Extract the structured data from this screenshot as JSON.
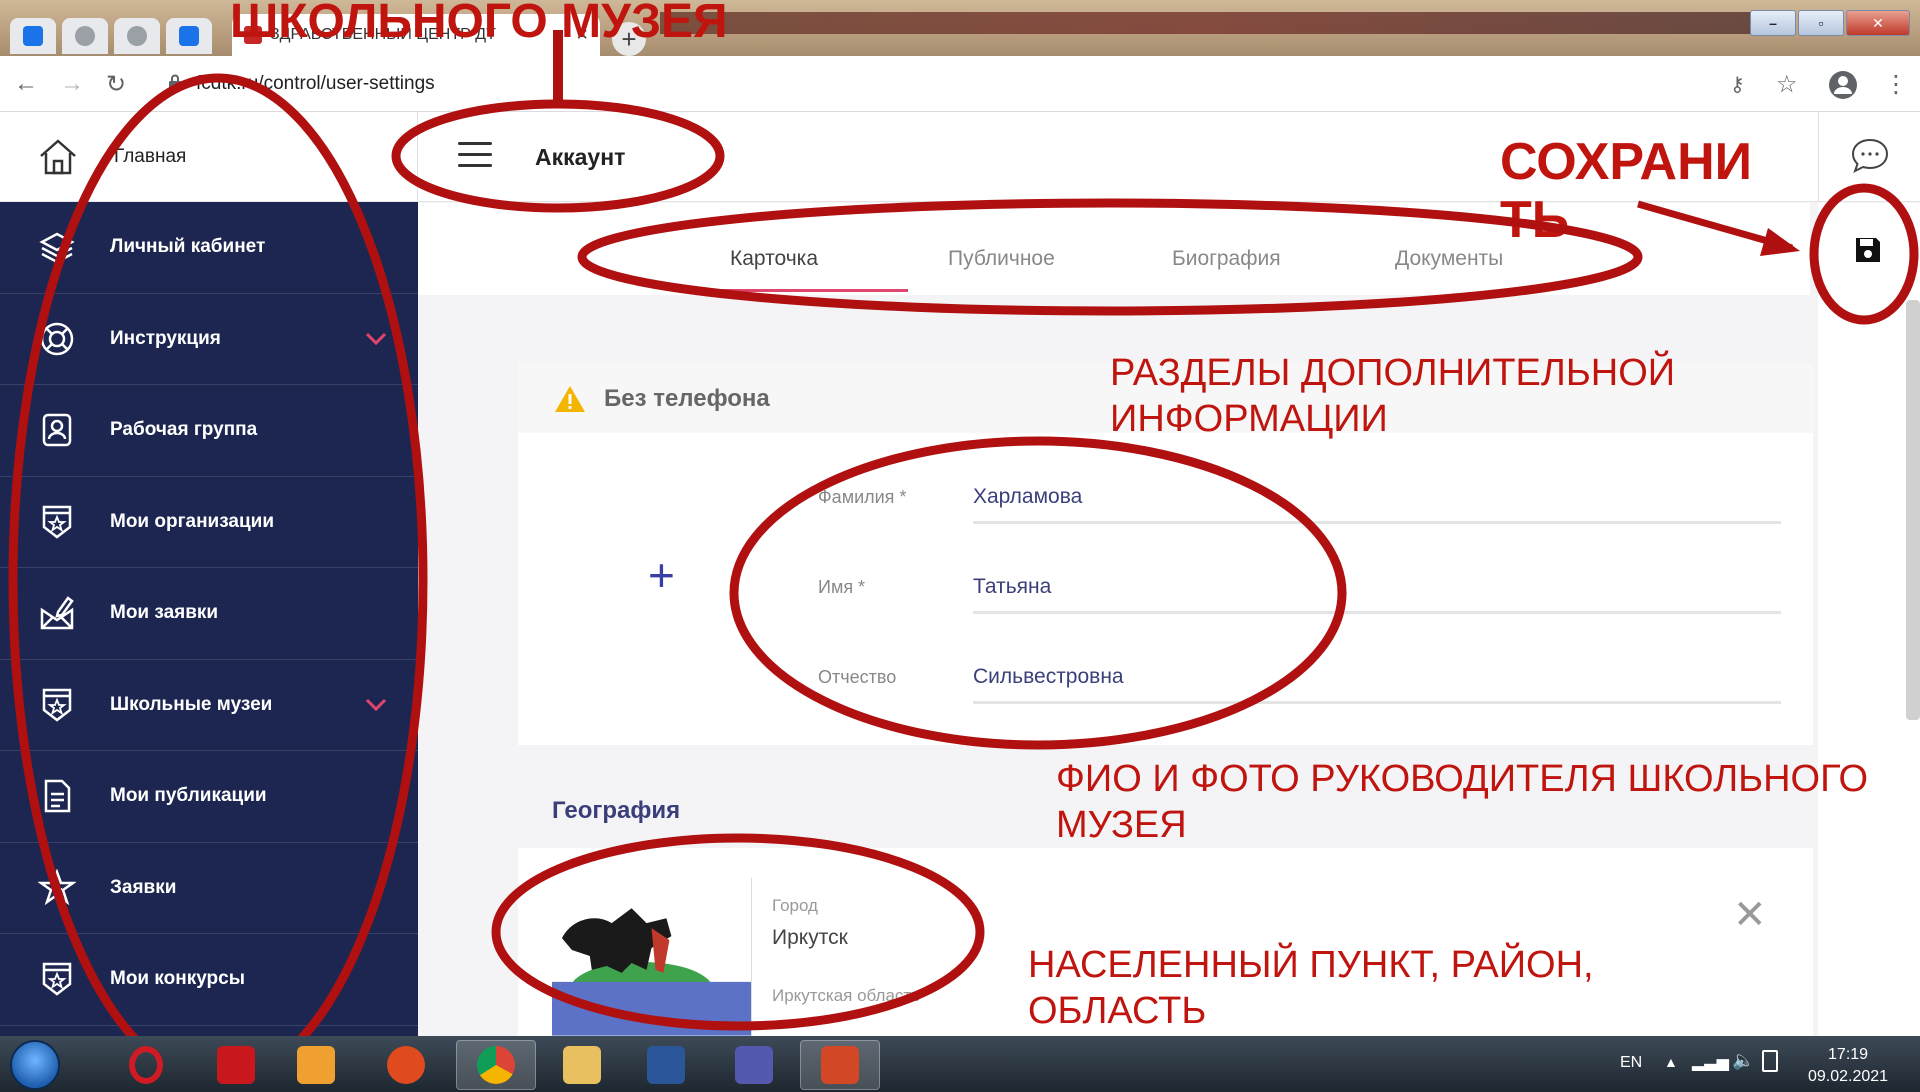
{
  "browser": {
    "active_tab_title": "ЗДРАВСТВЕННЫЙ ЦЕНТР ДТ",
    "url": "fcdtk.ru/control/user-settings"
  },
  "sidebar": {
    "home_label": "Главная",
    "items": [
      {
        "label": "Личный кабинет",
        "icon": "layers-icon",
        "expandable": false
      },
      {
        "label": "Инструкция",
        "icon": "lifebuoy-icon",
        "expandable": true
      },
      {
        "label": "Рабочая группа",
        "icon": "user-badge-icon",
        "expandable": false
      },
      {
        "label": "Мои организации",
        "icon": "star-shield-icon",
        "expandable": false
      },
      {
        "label": "Мои заявки",
        "icon": "envelope-edit-icon",
        "expandable": false
      },
      {
        "label": "Школьные музеи",
        "icon": "star-shield-icon",
        "expandable": true
      },
      {
        "label": "Мои публикации",
        "icon": "document-icon",
        "expandable": false
      },
      {
        "label": "Заявки",
        "icon": "star-burst-icon",
        "expandable": false
      },
      {
        "label": "Мои конкурсы",
        "icon": "star-shield-icon",
        "expandable": false
      }
    ]
  },
  "header": {
    "title": "Аккаунт"
  },
  "tabs": [
    {
      "label": "Карточка",
      "active": true
    },
    {
      "label": "Публичное",
      "active": false
    },
    {
      "label": "Биография",
      "active": false
    },
    {
      "label": "Документы",
      "active": false
    }
  ],
  "card": {
    "warning": "Без телефона",
    "fields": [
      {
        "label": "Фамилия *",
        "value": "Харламова"
      },
      {
        "label": "Имя *",
        "value": "Татьяна"
      },
      {
        "label": "Отчество",
        "value": "Сильвестровна"
      }
    ]
  },
  "geography": {
    "title": "География",
    "city_label": "Город",
    "city": "Иркутск",
    "region": "Иркутская область"
  },
  "annotations": {
    "top_heading": "ШКОЛЬНОГО МУЗЕЯ",
    "save_line1": "СОХРАНИ",
    "save_line2": "ТЬ",
    "sections_line1": "РАЗДЕЛЫ ДОПОЛНИТЕЛЬНОЙ",
    "sections_line2": "ИНФОРМАЦИИ",
    "fio_line1": "ФИО И ФОТО РУКОВОДИТЕЛЯ ШКОЛЬНОГО",
    "fio_line2": "МУЗЕЯ",
    "place_line1": "НАСЕЛЕННЫЙ ПУНКТ, РАЙОН,",
    "place_line2": "ОБЛАСТЬ"
  },
  "taskbar": {
    "lang": "EN",
    "time": "17:19",
    "date": "09.02.2021"
  },
  "colors": {
    "sidebar_bg": "#1d2650",
    "accent_pink": "#e0456e",
    "annotation_red": "#c0140f",
    "field_value": "#3a3f7a"
  }
}
